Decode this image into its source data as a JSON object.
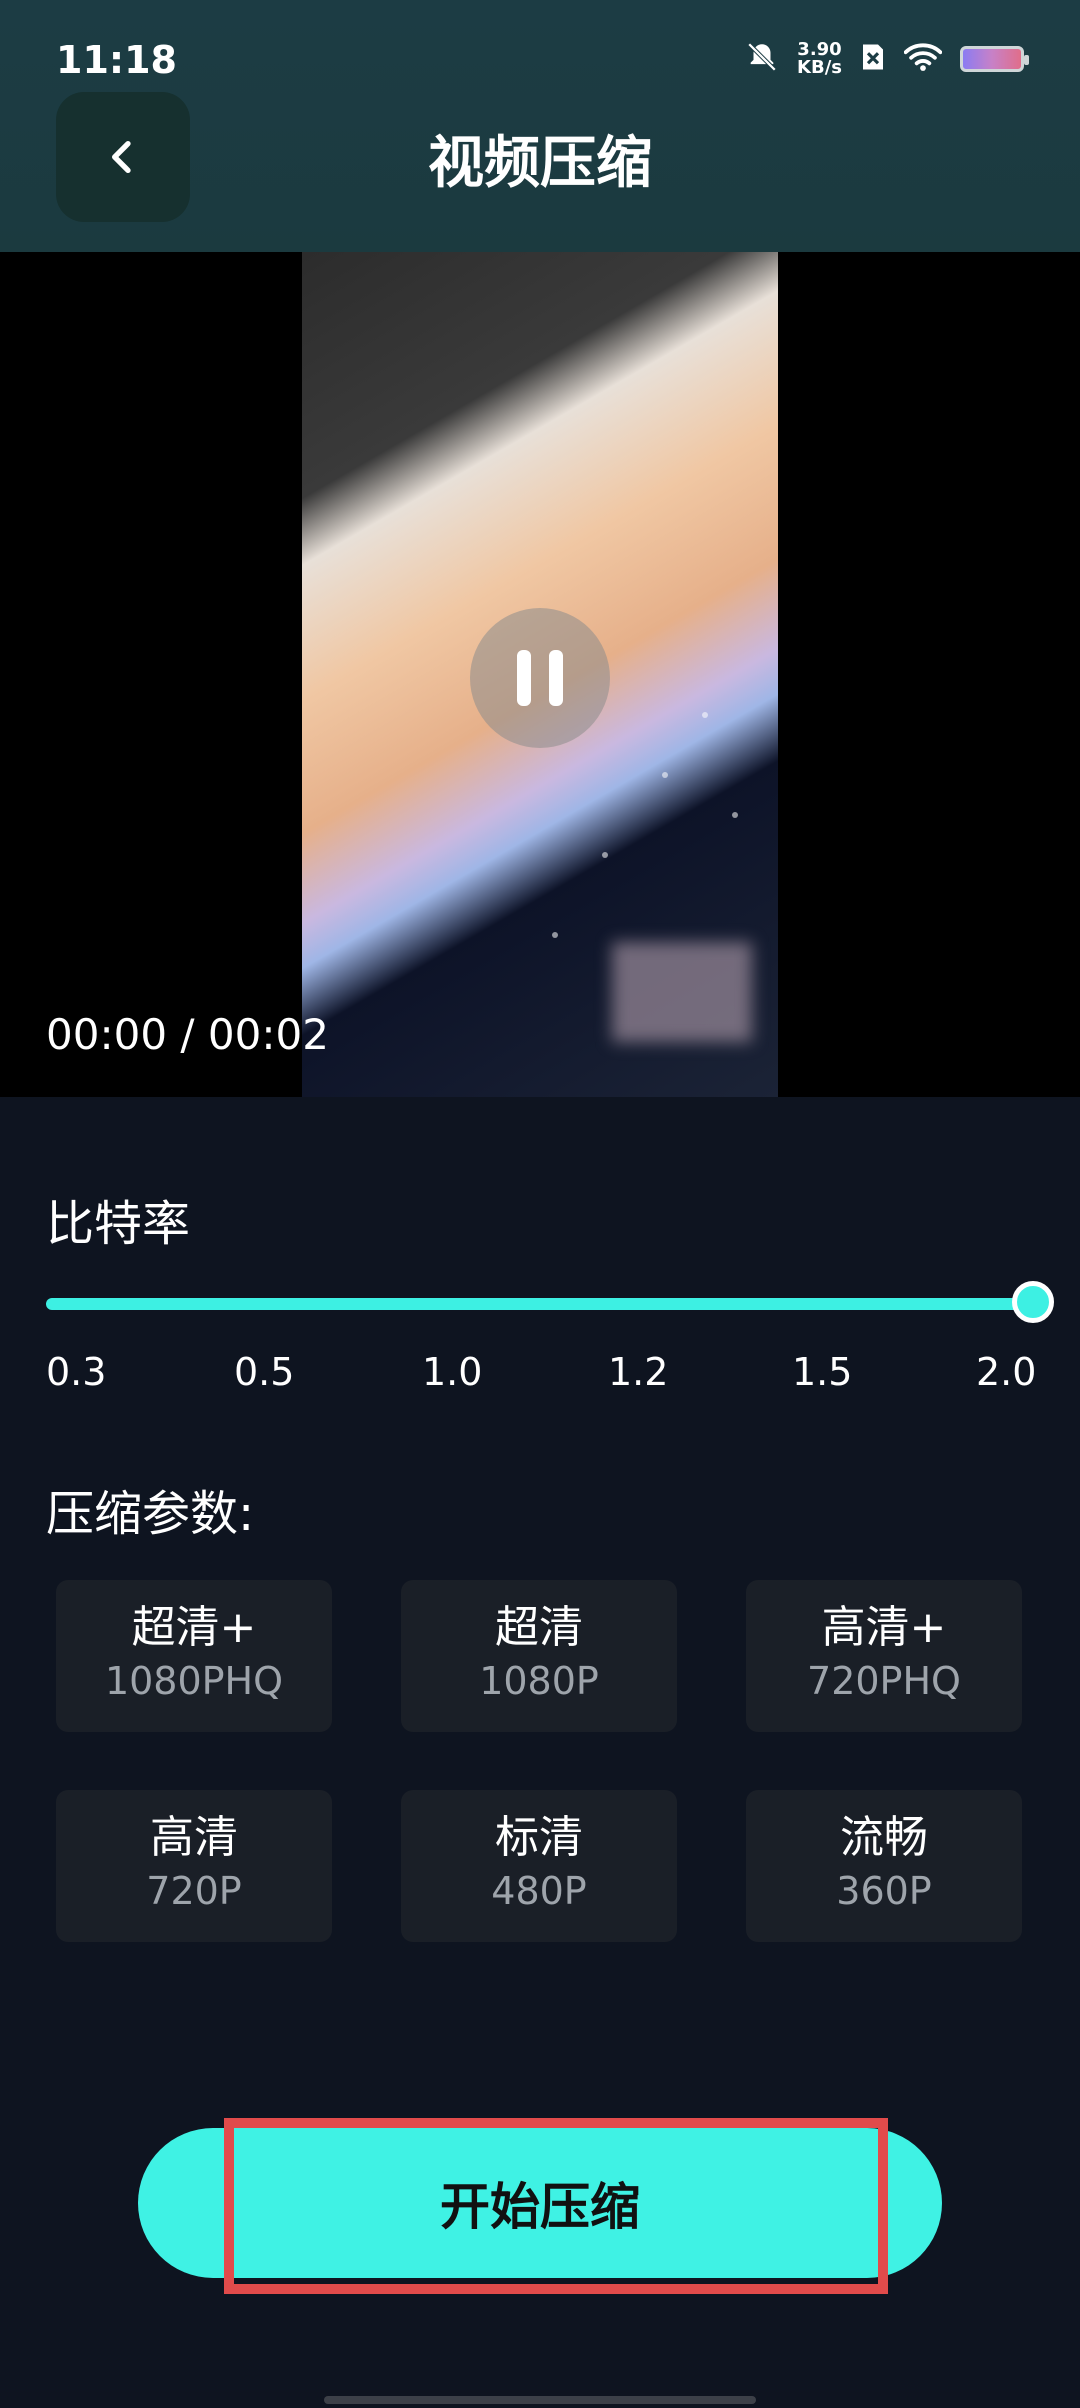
{
  "status_bar": {
    "time": "11:18",
    "net_speed_value": "3.90",
    "net_speed_unit": "KB/s",
    "icons": [
      "bell-muted-icon",
      "sim-off-icon",
      "wifi-icon",
      "battery-icon"
    ]
  },
  "header": {
    "title": "视频压缩",
    "back_icon": "chevron-left-icon"
  },
  "video": {
    "timecode": "00:00 / 00:02",
    "state": "playing",
    "pause_icon": "pause-icon"
  },
  "bitrate": {
    "label": "比特率",
    "ticks": [
      "0.3",
      "0.5",
      "1.0",
      "1.2",
      "1.5",
      "2.0"
    ],
    "selected": "2.0"
  },
  "params": {
    "label": "压缩参数:",
    "presets": [
      {
        "name": "超清+",
        "res": "1080PHQ"
      },
      {
        "name": "超清",
        "res": "1080P"
      },
      {
        "name": "高清+",
        "res": "720PHQ"
      },
      {
        "name": "高清",
        "res": "720P"
      },
      {
        "name": "标清",
        "res": "480P"
      },
      {
        "name": "流畅",
        "res": "360P"
      }
    ]
  },
  "actions": {
    "start": "开始压缩"
  },
  "colors": {
    "accent": "#3ff2e4",
    "header_bg": "#1c3c44",
    "page_bg": "#0e1420",
    "highlight": "#e14b4b"
  }
}
